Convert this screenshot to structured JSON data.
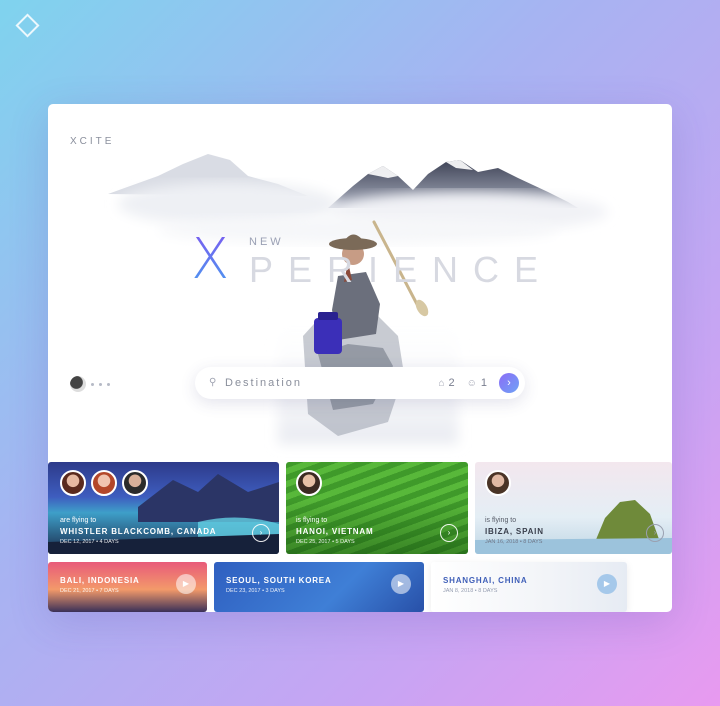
{
  "brand": "XCITE",
  "hero": {
    "new_label": "NEW",
    "x_letter": "X",
    "rest": "PERIENCE"
  },
  "search": {
    "placeholder": "Destination",
    "adults": "2",
    "children": "1",
    "go_glyph": "›"
  },
  "trips": [
    {
      "sub": "are flying to",
      "dest": "WHISTLER BLACKCOMB, CANADA",
      "date": "DEC 12, 2017 • 4 DAYS"
    },
    {
      "sub": "is flying to",
      "dest": "HANOI, VIETNAM",
      "date": "DEC 25, 2017 • 5 DAYS"
    },
    {
      "sub": "is flying to",
      "dest": "IBIZA, SPAIN",
      "date": "JAN 16, 2018 • 8 DAYS"
    },
    {
      "sub": "",
      "dest": "BALI, INDONESIA",
      "date": "DEC 21, 2017 • 7 DAYS"
    },
    {
      "sub": "",
      "dest": "SEOUL, SOUTH KOREA",
      "date": "DEC 23, 2017 • 3 DAYS"
    },
    {
      "sub": "",
      "dest": "SHANGHAI, CHINA",
      "date": "JAN 8, 2018 • 8 DAYS"
    }
  ],
  "icons": {
    "search": "search-icon",
    "adults": "home-icon",
    "children": "person-icon",
    "play": "play-icon",
    "next": "chevron-right-icon"
  },
  "colors": {
    "accent": "#7a5cf0",
    "accent2": "#4a9af0"
  }
}
